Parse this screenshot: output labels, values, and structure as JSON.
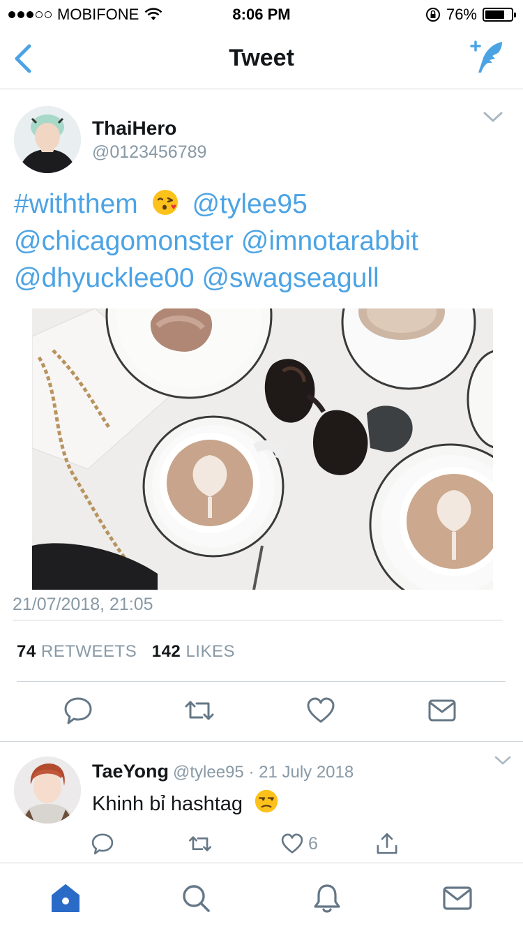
{
  "status_bar": {
    "carrier": "MOBIFONE",
    "time": "8:06 PM",
    "battery_percent": "76%",
    "battery_level": 0.76,
    "signal_bars_filled": 3,
    "signal_bars_total": 5
  },
  "nav": {
    "title": "Tweet",
    "back_icon": "chevron-left-icon",
    "compose_icon": "compose-tweet-icon"
  },
  "tweet": {
    "author_name": "ThaiHero",
    "author_handle": "@0123456789",
    "text_parts": {
      "hashtag": "#withthem",
      "mention_1": "@tylee95",
      "mention_2": "@chicagomonster",
      "mention_3": "@imnotarabbit",
      "mention_4": "@dhyucklee00",
      "mention_5": "@swagseagull"
    },
    "emoji": "face-blowing-a-kiss",
    "image": "coffee-latte-art-flatlay",
    "timestamp": "21/07/2018, 21:05",
    "retweets_count": "74",
    "retweets_label": "RETWEETS",
    "likes_count": "142",
    "likes_label": "LIKES"
  },
  "reply": {
    "author_name": "TaeYong",
    "author_handle": "@tylee95",
    "separator": "·",
    "date": "21 July 2018",
    "text": "Khinh bỉ hashtag",
    "emoji": "unamused-face",
    "like_count": "6"
  },
  "tab_bar": {
    "items": [
      "home-icon",
      "search-icon",
      "notifications-icon",
      "messages-icon"
    ],
    "active": "home-icon"
  },
  "colors": {
    "link_blue": "#4ca3e4",
    "twitter_blue": "#1da1f2",
    "home_active": "#2b6bc8",
    "secondary_text": "#8899a6",
    "icon_gray": "#657786"
  }
}
